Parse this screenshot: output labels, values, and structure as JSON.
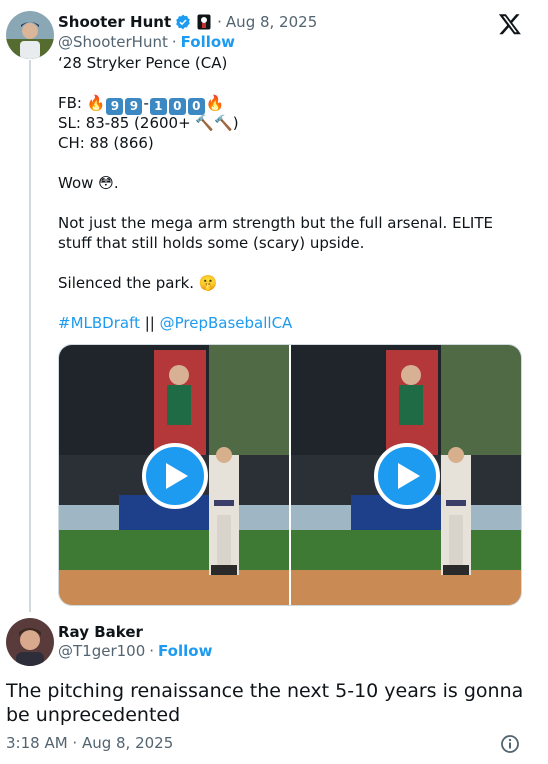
{
  "quoted": {
    "author_name": "Shooter Hunt",
    "handle": "@ShooterHunt",
    "date": "Aug 8, 2025",
    "follow_label": "Follow",
    "lines": {
      "l1": "‘28 Stryker Pence (CA)",
      "fb_prefix": "FB: ",
      "fb_d1": "9",
      "fb_d2": "9",
      "fb_dash": "-",
      "fb_d3": "1",
      "fb_d4": "0",
      "fb_d5": "0",
      "sl_prefix": "SL: 83-85 (2600+ ",
      "sl_suffix": ")",
      "ch": "CH: 88 (866)",
      "wow_prefix": "Wow ",
      "wow_suffix": ".",
      "p1": "Not just the mega arm strength but the full arsenal. ELITE",
      "p2": "stuff that still holds some (scary) upside.",
      "silenced": "Silenced the park. ",
      "hashtag": "#MLBDraft",
      "separator": " || ",
      "mention": "@PrepBaseballCA"
    },
    "emoji": {
      "fire": "🔥",
      "hammer": "🔨",
      "flushed": "😳",
      "shush": "🤫"
    }
  },
  "reply": {
    "author_name": "Ray Baker",
    "handle": "@T1ger100",
    "follow_label": "Follow",
    "text": "The pitching renaissance the next 5-10 years is gonna be unprecedented",
    "time": "3:18 AM · Aug 8, 2025"
  },
  "colors": {
    "accent": "#1d9bf0",
    "text": "#0f1419",
    "muted": "#536471",
    "border": "#cfd9de"
  },
  "icons": {
    "verified": "verified-badge-icon",
    "brand": "x-logo-icon",
    "play": "play-icon",
    "info": "info-icon"
  }
}
